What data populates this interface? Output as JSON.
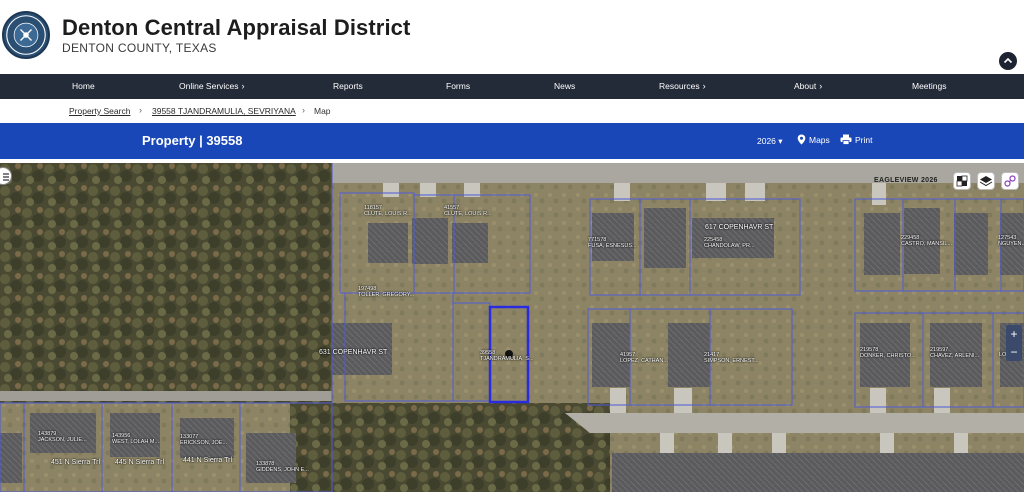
{
  "header": {
    "title": "Denton Central Appraisal District",
    "subtitle": "DENTON COUNTY, TEXAS",
    "seal_icon": "county-seal-logo",
    "seal_text": "DENTON CENTRAL APPRAISAL DISTRICT"
  },
  "nav": {
    "items": [
      {
        "label": "Home",
        "has_menu": false
      },
      {
        "label": "Online Services",
        "has_menu": true
      },
      {
        "label": "Reports",
        "has_menu": false
      },
      {
        "label": "Forms",
        "has_menu": false
      },
      {
        "label": "News",
        "has_menu": false
      },
      {
        "label": "Resources",
        "has_menu": true
      },
      {
        "label": "About",
        "has_menu": true
      },
      {
        "label": "Meetings",
        "has_menu": false
      }
    ],
    "chevron": "›"
  },
  "breadcrumb": {
    "items": [
      "Property Search",
      "39558 TJANDRAMULIA, SEVRIYANA",
      "Map"
    ],
    "separator": "›"
  },
  "property_bar": {
    "title": "Property | 39558",
    "year": "2026",
    "year_caret": "▾",
    "maps_label": "Maps",
    "print_label": "Print",
    "color": "#1947b8"
  },
  "map": {
    "imagery_label": "EAGLEVIEW 2026",
    "streets": [
      "617 COPENHAVR ST",
      "631 COPENHAVR ST",
      "451 N Sierra Trl",
      "445 N Sierra Trl",
      "441 N Sierra Trl"
    ],
    "parcels": [
      "118157\nCLUTE, LOUIS R...",
      "41557\nCLUTE, LOUIS R...",
      "771578\nFUSA, ESNESUS...",
      "225458\nCHANDOLAW, PR...",
      "229458\nCASTRO, MANSIL...",
      "127543\nNGUYEN...",
      "197498\nTOLLER, GREGORY...",
      "39558\nTJANDRAMULIA, S...",
      "41957\nLOPEZ, CATHAN...",
      "21417\nSIMPSON, ERNEST...",
      "219578\nDONKER, CHRISTO...",
      "219597\nCHAVEZ, ARLENI...",
      "LONGS...",
      "143879\nJACKSON, JULIE...",
      "143956\nWEST, LOLAH M...",
      "133077\nERICKSON, JOE...",
      "133878\nGIDDENS, JOHN E..."
    ],
    "selected_parcel_color": "#2a2ae0",
    "parcel_line_color": "#4f5bd6",
    "zoom_in": "+",
    "zoom_out": "−"
  }
}
